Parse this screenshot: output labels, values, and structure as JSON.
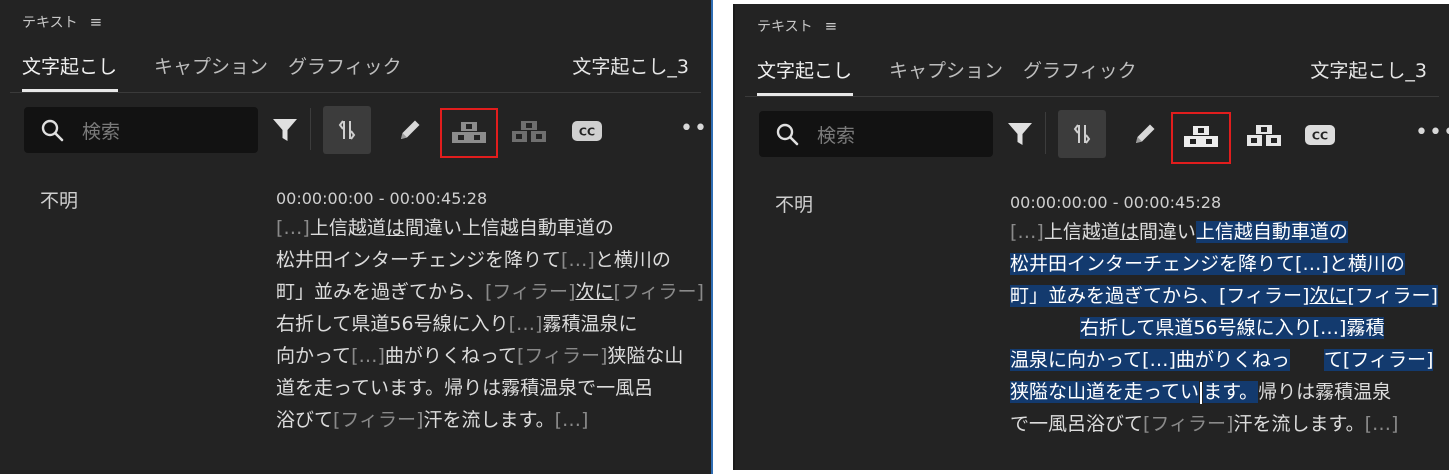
{
  "panel": {
    "title": "テキスト",
    "menu_glyph": "≡",
    "tabs": [
      "文字起こし",
      "キャプション",
      "グラフィック"
    ],
    "sequence_name": "文字起こし_3",
    "search_placeholder": "検索",
    "more_glyph": "•••",
    "cc_label": "CC"
  },
  "transcript": {
    "speaker": "不明",
    "timecode": "00:00:00:00 - 00:00:45:28",
    "ellipsis": "[…]",
    "filler": "[フィラー]"
  },
  "left_lines": [
    [
      {
        "t": "[…]",
        "k": "f"
      },
      {
        "t": "上信越道"
      },
      {
        "t": "は",
        "k": "u"
      },
      {
        "t": "間違い上信越自動車道の"
      }
    ],
    [
      {
        "t": "松井田インターチェンジを降りて"
      },
      {
        "t": "[…]",
        "k": "f"
      },
      {
        "t": "と横川の"
      }
    ],
    [
      {
        "t": "町」並みを過ぎてから、"
      },
      {
        "t": "[フィラー]",
        "k": "f"
      },
      {
        "t": "次に",
        "k": "u"
      },
      {
        "t": "[フィラー]",
        "k": "f"
      }
    ],
    [
      {
        "t": "右折して県道56号線に入り"
      },
      {
        "t": "[…]",
        "k": "f"
      },
      {
        "t": "霧積温泉に"
      }
    ],
    [
      {
        "t": "向かって"
      },
      {
        "t": "[…]",
        "k": "f"
      },
      {
        "t": "曲がりくねって"
      },
      {
        "t": "[フィラー]",
        "k": "f"
      },
      {
        "t": "狭隘な山"
      }
    ],
    [
      {
        "t": "道を走っています。帰りは霧積温泉で一風呂"
      }
    ],
    [
      {
        "t": "浴びて"
      },
      {
        "t": "[フィラー]",
        "k": "f"
      },
      {
        "t": "汗を流します。"
      },
      {
        "t": "[…]",
        "k": "f"
      }
    ]
  ],
  "right_lines": [
    [
      {
        "t": "[…]",
        "k": "f"
      },
      {
        "t": "上信越道"
      },
      {
        "t": "は",
        "k": "u"
      },
      {
        "t": "間違い"
      },
      {
        "t": "上信越自動車道の",
        "k": "h"
      }
    ],
    [
      {
        "t": "松井田インターチェンジを降りて",
        "k": "h"
      },
      {
        "t": "[…]",
        "k": "hf"
      },
      {
        "t": "と横川の",
        "k": "h"
      }
    ],
    [
      {
        "t": "町」並みを過ぎてから、",
        "k": "h"
      },
      {
        "t": "[フィラー]",
        "k": "hf"
      },
      {
        "t": "次に",
        "k": "hu"
      },
      {
        "t": "[フィラー]",
        "k": "hf"
      }
    ],
    [
      {
        "t": "右折して県道56号線に入り",
        "k": "h"
      },
      {
        "t": "[…]",
        "k": "hf"
      },
      {
        "t": "霧積",
        "k": "h"
      }
    ],
    [
      {
        "t": "温泉に向かって",
        "k": "h"
      },
      {
        "t": "[…]",
        "k": "hf"
      },
      {
        "t": "曲がりくねっ",
        "k": "h"
      },
      {
        "t": "て",
        "k": "h"
      },
      {
        "t": "[フィラー]",
        "k": "hf"
      }
    ],
    [
      {
        "t": "狭隘な山道を走ってい",
        "k": "h"
      },
      {
        "t": "ます。",
        "k": "h"
      },
      {
        "t": "帰りは霧積温泉"
      }
    ],
    [
      {
        "t": "で一風呂浴びて"
      },
      {
        "t": "[フィラー]",
        "k": "f"
      },
      {
        "t": "汗を流します。"
      },
      {
        "t": "[…]",
        "k": "f"
      }
    ]
  ],
  "colors": {
    "panel_bg": "#232323",
    "selection": "#133a6e",
    "red_highlight": "#e11d1d",
    "frame_blue": "#2f6db3"
  },
  "icons": [
    "search-icon",
    "filter-icon",
    "split-icon",
    "pencil-icon",
    "merge-segments-icon",
    "split-segments-icon",
    "cc-icon",
    "more-icon"
  ]
}
